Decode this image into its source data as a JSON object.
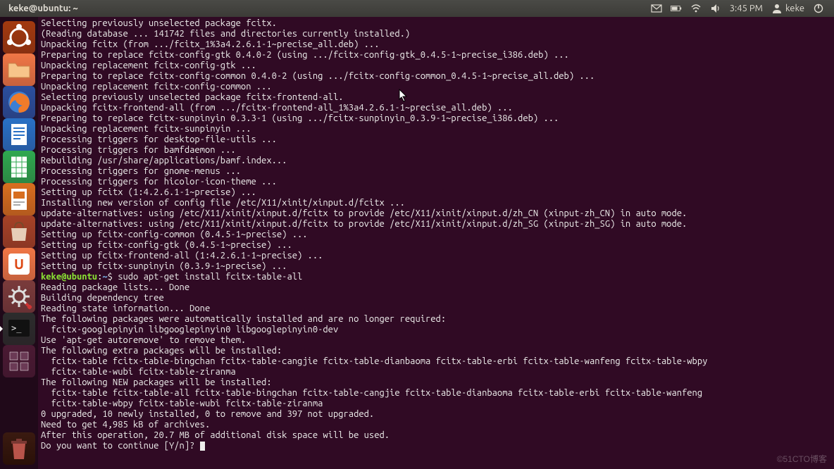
{
  "topbar": {
    "title": "keke@ubuntu: ~",
    "clock": "3:45 PM",
    "user": "keke"
  },
  "launcher": {
    "items": [
      {
        "name": "dash",
        "color": "#a33a0f",
        "icon": "ubuntu"
      },
      {
        "name": "files",
        "color": "#f07746",
        "icon": "folder"
      },
      {
        "name": "firefox",
        "color": "#2b4f9e",
        "icon": "firefox"
      },
      {
        "name": "writer",
        "color": "#2971c6",
        "icon": "doc"
      },
      {
        "name": "calc",
        "color": "#2fa84f",
        "icon": "sheet"
      },
      {
        "name": "impress",
        "color": "#d86e1f",
        "icon": "present"
      },
      {
        "name": "software",
        "color": "#a64227",
        "icon": "bag"
      },
      {
        "name": "ubuntu-one",
        "color": "#f07746",
        "icon": "u1"
      },
      {
        "name": "settings",
        "color": "#7a3b3b",
        "icon": "gear"
      },
      {
        "name": "terminal",
        "color": "#2c2c2c",
        "icon": "term",
        "active": true
      },
      {
        "name": "workspaces",
        "color": "#4a1a33",
        "icon": "grid"
      }
    ],
    "trash": {
      "name": "trash",
      "color": "#333",
      "icon": "trash"
    }
  },
  "terminal": {
    "lines": [
      "Selecting previously unselected package fcitx.",
      "(Reading database ... 141742 files and directories currently installed.)",
      "Unpacking fcitx (from .../fcitx_1%3a4.2.6.1-1~precise_all.deb) ...",
      "Preparing to replace fcitx-config-gtk 0.4.0-2 (using .../fcitx-config-gtk_0.4.5-1~precise_i386.deb) ...",
      "Unpacking replacement fcitx-config-gtk ...",
      "Preparing to replace fcitx-config-common 0.4.0-2 (using .../fcitx-config-common_0.4.5-1~precise_all.deb) ...",
      "Unpacking replacement fcitx-config-common ...",
      "Selecting previously unselected package fcitx-frontend-all.",
      "Unpacking fcitx-frontend-all (from .../fcitx-frontend-all_1%3a4.2.6.1-1~precise_all.deb) ...",
      "Preparing to replace fcitx-sunpinyin 0.3.3-1 (using .../fcitx-sunpinyin_0.3.9-1~precise_i386.deb) ...",
      "Unpacking replacement fcitx-sunpinyin ...",
      "Processing triggers for desktop-file-utils ...",
      "Processing triggers for bamfdaemon ...",
      "Rebuilding /usr/share/applications/bamf.index...",
      "Processing triggers for gnome-menus ...",
      "Processing triggers for hicolor-icon-theme ...",
      "Setting up fcitx (1:4.2.6.1-1~precise) ...",
      "Installing new version of config file /etc/X11/xinit/xinput.d/fcitx ...",
      "update-alternatives: using /etc/X11/xinit/xinput.d/fcitx to provide /etc/X11/xinit/xinput.d/zh_CN (xinput-zh_CN) in auto mode.",
      "update-alternatives: using /etc/X11/xinit/xinput.d/fcitx to provide /etc/X11/xinit/xinput.d/zh_SG (xinput-zh_SG) in auto mode.",
      "Setting up fcitx-config-common (0.4.5-1~precise) ...",
      "Setting up fcitx-config-gtk (0.4.5-1~precise) ...",
      "Setting up fcitx-frontend-all (1:4.2.6.1-1~precise) ...",
      "Setting up fcitx-sunpinyin (0.3.9-1~precise) ..."
    ],
    "prompt_user": "keke@ubuntu",
    "prompt_path": "~",
    "command": "sudo apt-get install fcitx-table-all",
    "lines2": [
      "Reading package lists... Done",
      "Building dependency tree       ",
      "Reading state information... Done",
      "The following packages were automatically installed and are no longer required:",
      "  fcitx-googlepinyin libgooglepinyin0 libgooglepinyin0-dev",
      "Use 'apt-get autoremove' to remove them.",
      "The following extra packages will be installed:",
      "  fcitx-table fcitx-table-bingchan fcitx-table-cangjie fcitx-table-dianbaoma fcitx-table-erbi fcitx-table-wanfeng fcitx-table-wbpy",
      "  fcitx-table-wubi fcitx-table-ziranma",
      "The following NEW packages will be installed:",
      "  fcitx-table fcitx-table-all fcitx-table-bingchan fcitx-table-cangjie fcitx-table-dianbaoma fcitx-table-erbi fcitx-table-wanfeng",
      "  fcitx-table-wbpy fcitx-table-wubi fcitx-table-ziranma",
      "0 upgraded, 10 newly installed, 0 to remove and 397 not upgraded.",
      "Need to get 4,985 kB of archives.",
      "After this operation, 20.7 MB of additional disk space will be used.",
      "Do you want to continue [Y/n]? "
    ]
  },
  "watermark": "©51CTO博客"
}
